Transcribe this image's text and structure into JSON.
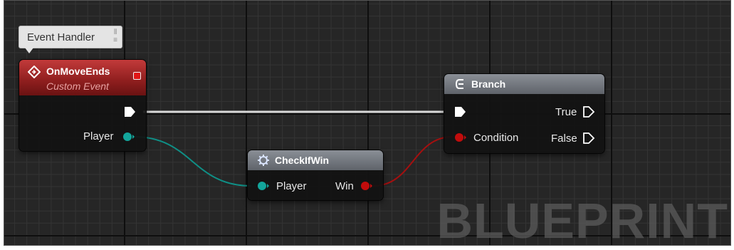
{
  "comment": {
    "text": "Event Handler"
  },
  "event_node": {
    "title": "OnMoveEnds",
    "subtitle": "Custom Event",
    "output_pin": "Player"
  },
  "function_node": {
    "title": "CheckIfWin",
    "input_pin": "Player",
    "output_pin": "Win"
  },
  "branch_node": {
    "title": "Branch",
    "input_pin": "Condition",
    "true_pin": "True",
    "false_pin": "False"
  },
  "watermark": "BLUEPRINT",
  "colors": {
    "object_pin": "#13a59b",
    "bool_pin": "#c10c0c",
    "exec_wire": "#e6e6e6",
    "event_header": "#a82626",
    "function_header": "#787d84"
  }
}
